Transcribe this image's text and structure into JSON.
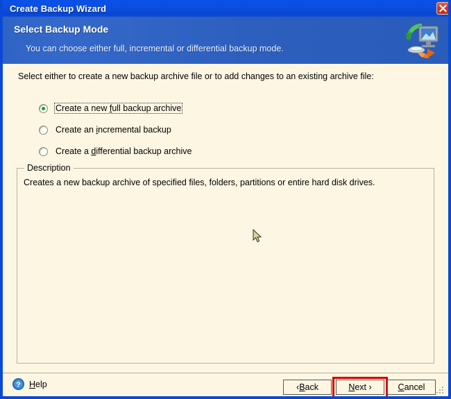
{
  "window": {
    "title": "Create Backup Wizard",
    "close_icon": "close-icon"
  },
  "banner": {
    "title": "Select Backup Mode",
    "subtitle": "You can choose either full, incremental or differential backup mode.",
    "icon": "backup-computer-icon"
  },
  "content": {
    "intro": "Select either to create a new backup archive file or to add changes to an existing archive file:",
    "options": [
      {
        "pre": "Create a new ",
        "accel": "f",
        "post": "ull backup archive",
        "selected": true,
        "focused": true
      },
      {
        "pre": "Create an ",
        "accel": "i",
        "post": "ncremental backup",
        "selected": false,
        "focused": false
      },
      {
        "pre": "Create a ",
        "accel": "d",
        "post": "ifferential backup archive",
        "selected": false,
        "focused": false
      }
    ],
    "description": {
      "legend": "Description",
      "text": "Creates a new backup archive of specified files, folders, partitions or entire hard disk drives."
    }
  },
  "footer": {
    "help_icon": "question-mark-icon",
    "help_pre": "H",
    "help_accel": "H",
    "help_label_pre": "",
    "help_label_post": "elp",
    "buttons": [
      {
        "pre": "‹ ",
        "accel": "B",
        "post": "ack",
        "name": "back-button"
      },
      {
        "pre": "",
        "accel": "N",
        "post": "ext ›",
        "name": "next-button"
      },
      {
        "pre": "",
        "accel": "C",
        "post": "ancel",
        "name": "cancel-button"
      }
    ]
  },
  "colors": {
    "titlebar_blue": "#0a4fe0",
    "banner_blue": "#2c5fbe",
    "window_border": "#0a49d8",
    "content_bg": "#fdf6e3",
    "highlight_red": "#d40000",
    "radio_green": "#10a810",
    "help_blue": "#1f6fc4"
  }
}
